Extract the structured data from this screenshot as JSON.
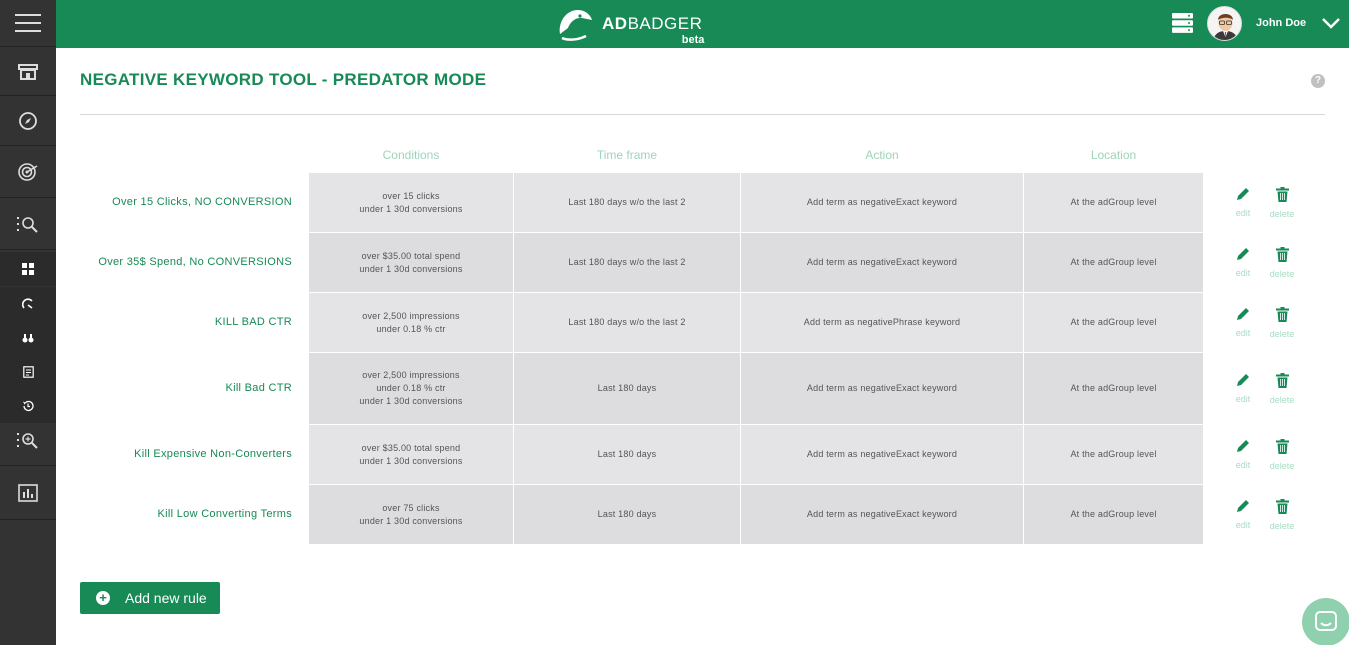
{
  "header": {
    "brand_prefix": "AD",
    "brand_name": "BADGER",
    "brand_tag": "beta",
    "user_name": "John Doe"
  },
  "page": {
    "title": "NEGATIVE KEYWORD TOOL - PREDATOR MODE",
    "help": "?"
  },
  "table": {
    "columns": [
      "Conditions",
      "Time frame",
      "Action",
      "Location"
    ],
    "rows": [
      {
        "name": "Over 15 Clicks, NO CONVERSION",
        "conditions": [
          "over 15 clicks",
          "under 1 30d conversions"
        ],
        "timeframe": "Last 180 days w/o the last 2",
        "action": "Add term as negativeExact keyword",
        "location": "At the adGroup level"
      },
      {
        "name": "Over 35$ Spend, No CONVERSIONS",
        "conditions": [
          "over $35.00 total spend",
          "under 1 30d conversions"
        ],
        "timeframe": "Last 180 days w/o the last 2",
        "action": "Add term as negativeExact keyword",
        "location": "At the adGroup level"
      },
      {
        "name": "KILL BAD CTR",
        "conditions": [
          "over 2,500 impressions",
          "under 0.18 % ctr"
        ],
        "timeframe": "Last 180 days w/o the last 2",
        "action": "Add term as negativePhrase keyword",
        "location": "At the adGroup level"
      },
      {
        "name": "Kill Bad CTR",
        "conditions": [
          "over 2,500 impressions",
          "under 0.18 % ctr",
          "under 1 30d conversions"
        ],
        "timeframe": "Last 180 days",
        "action": "Add term as negativeExact keyword",
        "location": "At the adGroup level"
      },
      {
        "name": "Kill Expensive Non-Converters",
        "conditions": [
          "over $35.00 total spend",
          "under 1 30d conversions"
        ],
        "timeframe": "Last 180 days",
        "action": "Add term as negativeExact keyword",
        "location": "At the adGroup level"
      },
      {
        "name": "Kill Low Converting Terms",
        "conditions": [
          "over 75 clicks",
          "under 1 30d conversions"
        ],
        "timeframe": "Last 180 days",
        "action": "Add term as negativeExact keyword",
        "location": "At the adGroup level"
      }
    ],
    "edit_label": "edit",
    "delete_label": "delete"
  },
  "add_button_label": "Add new rule",
  "colors": {
    "brand_green": "#178a55",
    "sidebar": "#333333",
    "cell": "#e4e4e6",
    "muted_green": "#9fd3bb"
  },
  "icons": {
    "sidebar": [
      "menu-icon",
      "store-icon",
      "compass-icon",
      "target-icon",
      "search-list-icon",
      "dashboard-icon",
      "gauge-icon",
      "binoculars-icon",
      "report-icon",
      "history-icon",
      "search-list-icon",
      "chart-icon"
    ],
    "header": [
      "adbadger-logo",
      "server-icon",
      "avatar",
      "chevron-down-icon"
    ]
  }
}
